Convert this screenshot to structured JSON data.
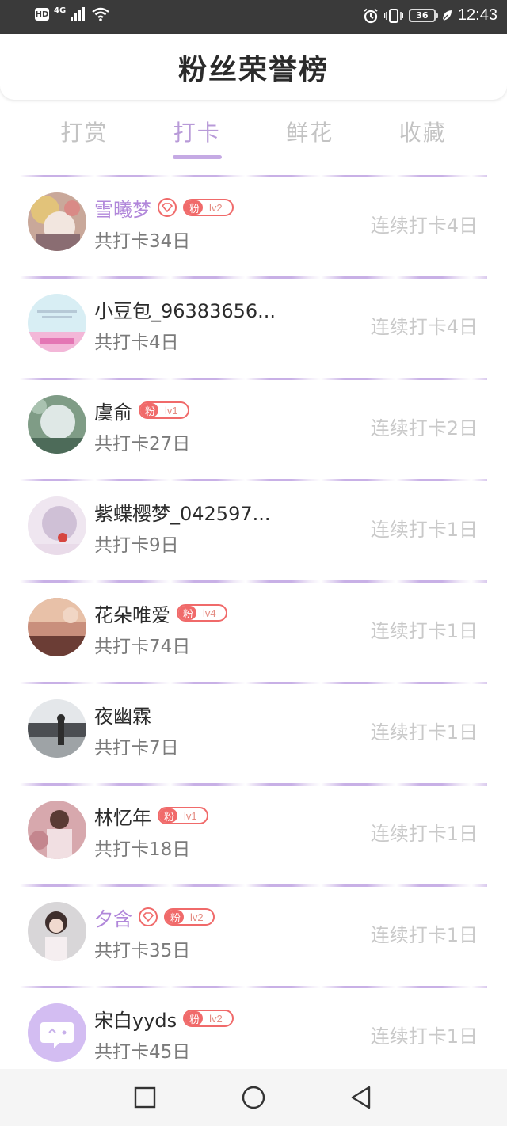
{
  "status_bar": {
    "hd": "HD",
    "network": "4G",
    "battery": "36",
    "time": "12:43",
    "icons": [
      "signal-icon",
      "wifi-icon",
      "alarm-icon",
      "vibrate-icon",
      "battery-icon",
      "leaf-icon"
    ]
  },
  "header": {
    "title": "粉丝荣誉榜"
  },
  "tabs": [
    {
      "label": "打赏",
      "active": false
    },
    {
      "label": "打卡",
      "active": true
    },
    {
      "label": "鲜花",
      "active": false
    },
    {
      "label": "收藏",
      "active": false
    }
  ],
  "fan_badge_char": "粉",
  "rows": [
    {
      "name": "雪曦梦",
      "vip": true,
      "level": "lv2",
      "total": "共打卡34日",
      "streak": "连续打卡4日"
    },
    {
      "name": "小豆包_96383656...",
      "vip": false,
      "level": null,
      "total": "共打卡4日",
      "streak": "连续打卡4日"
    },
    {
      "name": "虞俞",
      "vip": false,
      "level": "lv1",
      "total": "共打卡27日",
      "streak": "连续打卡2日"
    },
    {
      "name": "紫蝶樱梦_042597...",
      "vip": false,
      "level": null,
      "total": "共打卡9日",
      "streak": "连续打卡1日"
    },
    {
      "name": "花朵唯爱",
      "vip": false,
      "level": "lv4",
      "total": "共打卡74日",
      "streak": "连续打卡1日"
    },
    {
      "name": "夜幽霖",
      "vip": false,
      "level": null,
      "total": "共打卡7日",
      "streak": "连续打卡1日"
    },
    {
      "name": "林忆年",
      "vip": false,
      "level": "lv1",
      "total": "共打卡18日",
      "streak": "连续打卡1日"
    },
    {
      "name": "夕含",
      "vip": true,
      "level": "lv2",
      "total": "共打卡35日",
      "streak": "连续打卡1日"
    },
    {
      "name": "宋白yyds",
      "vip": false,
      "level": "lv2",
      "total": "共打卡45日",
      "streak": "连续打卡1日"
    }
  ],
  "colors": {
    "accent": "#b89ad8",
    "vip_name": "#b187da",
    "badge": "#f06a6a",
    "status_bar": "#3a3a3a",
    "muted_text": "#c9c9c9"
  },
  "nav_bar": {
    "icons": [
      "recent-apps-icon",
      "home-icon",
      "back-icon"
    ]
  }
}
